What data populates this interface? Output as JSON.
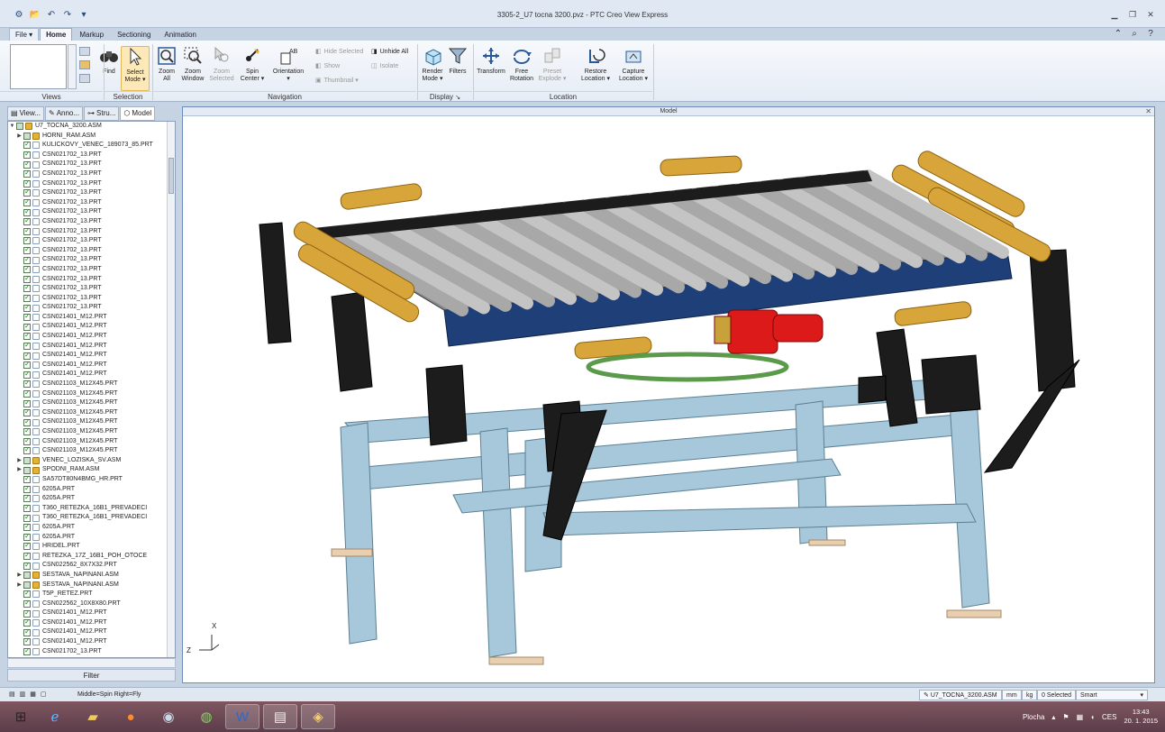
{
  "window": {
    "title": "3305-2_U7 tocna 3200.pvz - PTC Creo View Express"
  },
  "qat": {
    "icons": [
      "app-icon",
      "open-icon",
      "undo-icon",
      "redo-icon",
      "customize-icon"
    ]
  },
  "tabs": [
    {
      "label": "File ▾"
    },
    {
      "label": "Home"
    },
    {
      "label": "Markup"
    },
    {
      "label": "Sectioning"
    },
    {
      "label": "Animation"
    }
  ],
  "ribbon": {
    "find": "Find",
    "select_mode": [
      "Select",
      "Mode ▾"
    ],
    "zoom_all": [
      "Zoom",
      "All"
    ],
    "zoom_window": [
      "Zoom",
      "Window"
    ],
    "zoom_selected": [
      "Zoom",
      "Selected"
    ],
    "spin_center": [
      "Spin",
      "Center ▾"
    ],
    "orientation": [
      "Orientation",
      "▾"
    ],
    "hide_selected": "Hide Selected",
    "unhide_all": "Unhide All",
    "show": "Show",
    "isolate": "Isolate",
    "thumbnail": "Thumbnail ▾",
    "render_mode": [
      "Render",
      "Mode ▾"
    ],
    "filters": "Filters",
    "transform": "Transform",
    "free_rotation": [
      "Free",
      "Rotation"
    ],
    "preset_explode": [
      "Preset",
      "Explode ▾"
    ],
    "restore_location": [
      "Restore",
      "Location ▾"
    ],
    "capture_location": [
      "Capture",
      "Location ▾"
    ],
    "groups": {
      "views": "Views",
      "selection": "Selection",
      "navigation": "Navigation",
      "display": "Display",
      "location": "Location"
    }
  },
  "left_tabs": [
    {
      "label": "View..."
    },
    {
      "label": "Anno..."
    },
    {
      "label": "Stru..."
    },
    {
      "label": "Model"
    }
  ],
  "tree": [
    {
      "name": "U7_TOCNA_3200.ASM",
      "type": "asm",
      "level": 0,
      "twisty": "▼",
      "check": "part"
    },
    {
      "name": "HORNI_RAM.ASM",
      "type": "asm",
      "level": 1,
      "twisty": "▶",
      "check": "part"
    },
    {
      "name": "KULICKOVY_VENEC_189073_85.PRT",
      "type": "prt",
      "level": 1,
      "check": "on"
    },
    {
      "name": "CSN021702_13.PRT",
      "type": "prt",
      "level": 1,
      "check": "on"
    },
    {
      "name": "CSN021702_13.PRT",
      "type": "prt",
      "level": 1,
      "check": "on"
    },
    {
      "name": "CSN021702_13.PRT",
      "type": "prt",
      "level": 1,
      "check": "on"
    },
    {
      "name": "CSN021702_13.PRT",
      "type": "prt",
      "level": 1,
      "check": "on"
    },
    {
      "name": "CSN021702_13.PRT",
      "type": "prt",
      "level": 1,
      "check": "on"
    },
    {
      "name": "CSN021702_13.PRT",
      "type": "prt",
      "level": 1,
      "check": "on"
    },
    {
      "name": "CSN021702_13.PRT",
      "type": "prt",
      "level": 1,
      "check": "on"
    },
    {
      "name": "CSN021702_13.PRT",
      "type": "prt",
      "level": 1,
      "check": "on"
    },
    {
      "name": "CSN021702_13.PRT",
      "type": "prt",
      "level": 1,
      "check": "on"
    },
    {
      "name": "CSN021702_13.PRT",
      "type": "prt",
      "level": 1,
      "check": "on"
    },
    {
      "name": "CSN021702_13.PRT",
      "type": "prt",
      "level": 1,
      "check": "on"
    },
    {
      "name": "CSN021702_13.PRT",
      "type": "prt",
      "level": 1,
      "check": "on"
    },
    {
      "name": "CSN021702_13.PRT",
      "type": "prt",
      "level": 1,
      "check": "on"
    },
    {
      "name": "CSN021702_13.PRT",
      "type": "prt",
      "level": 1,
      "check": "on"
    },
    {
      "name": "CSN021702_13.PRT",
      "type": "prt",
      "level": 1,
      "check": "on"
    },
    {
      "name": "CSN021702_13.PRT",
      "type": "prt",
      "level": 1,
      "check": "on"
    },
    {
      "name": "CSN021702_13.PRT",
      "type": "prt",
      "level": 1,
      "check": "on"
    },
    {
      "name": "CSN021401_M12.PRT",
      "type": "prt",
      "level": 1,
      "check": "on"
    },
    {
      "name": "CSN021401_M12.PRT",
      "type": "prt",
      "level": 1,
      "check": "on"
    },
    {
      "name": "CSN021401_M12.PRT",
      "type": "prt",
      "level": 1,
      "check": "on"
    },
    {
      "name": "CSN021401_M12.PRT",
      "type": "prt",
      "level": 1,
      "check": "on"
    },
    {
      "name": "CSN021401_M12.PRT",
      "type": "prt",
      "level": 1,
      "check": "on"
    },
    {
      "name": "CSN021401_M12.PRT",
      "type": "prt",
      "level": 1,
      "check": "on"
    },
    {
      "name": "CSN021401_M12.PRT",
      "type": "prt",
      "level": 1,
      "check": "on"
    },
    {
      "name": "CSN021103_M12X45.PRT",
      "type": "prt",
      "level": 1,
      "check": "on"
    },
    {
      "name": "CSN021103_M12X45.PRT",
      "type": "prt",
      "level": 1,
      "check": "on"
    },
    {
      "name": "CSN021103_M12X45.PRT",
      "type": "prt",
      "level": 1,
      "check": "on"
    },
    {
      "name": "CSN021103_M12X45.PRT",
      "type": "prt",
      "level": 1,
      "check": "on"
    },
    {
      "name": "CSN021103_M12X45.PRT",
      "type": "prt",
      "level": 1,
      "check": "on"
    },
    {
      "name": "CSN021103_M12X45.PRT",
      "type": "prt",
      "level": 1,
      "check": "on"
    },
    {
      "name": "CSN021103_M12X45.PRT",
      "type": "prt",
      "level": 1,
      "check": "on"
    },
    {
      "name": "CSN021103_M12X45.PRT",
      "type": "prt",
      "level": 1,
      "check": "on"
    },
    {
      "name": "VENEC_LOZISKA_SV.ASM",
      "type": "asm",
      "level": 1,
      "twisty": "▶",
      "check": "part"
    },
    {
      "name": "SPODNI_RAM.ASM",
      "type": "asm",
      "level": 1,
      "twisty": "▶",
      "check": "part"
    },
    {
      "name": "SA57DT80N4BMG_HR.PRT",
      "type": "prt",
      "level": 1,
      "check": "on"
    },
    {
      "name": "6205A.PRT",
      "type": "prt",
      "level": 1,
      "check": "on"
    },
    {
      "name": "6205A.PRT",
      "type": "prt",
      "level": 1,
      "check": "on"
    },
    {
      "name": "T360_RETEZKA_16B1_PREVADECI",
      "type": "prt",
      "level": 1,
      "check": "on"
    },
    {
      "name": "T360_RETEZKA_16B1_PREVADECI",
      "type": "prt",
      "level": 1,
      "check": "on"
    },
    {
      "name": "6205A.PRT",
      "type": "prt",
      "level": 1,
      "check": "on"
    },
    {
      "name": "6205A.PRT",
      "type": "prt",
      "level": 1,
      "check": "on"
    },
    {
      "name": "HRIDEL.PRT",
      "type": "prt",
      "level": 1,
      "check": "on"
    },
    {
      "name": "RETEZKA_17Z_16B1_POH_OTOCE",
      "type": "prt",
      "level": 1,
      "check": "on"
    },
    {
      "name": "CSN022562_8X7X32.PRT",
      "type": "prt",
      "level": 1,
      "check": "on"
    },
    {
      "name": "SESTAVA_NAPINANI.ASM",
      "type": "asm",
      "level": 1,
      "twisty": "▶",
      "check": "part"
    },
    {
      "name": "SESTAVA_NAPINANI.ASM",
      "type": "asm",
      "level": 1,
      "twisty": "▶",
      "check": "part"
    },
    {
      "name": "T5P_RETEZ.PRT",
      "type": "prt",
      "level": 1,
      "check": "on"
    },
    {
      "name": "CSN022562_10X8X80.PRT",
      "type": "prt",
      "level": 1,
      "check": "on"
    },
    {
      "name": "CSN021401_M12.PRT",
      "type": "prt",
      "level": 1,
      "check": "on"
    },
    {
      "name": "CSN021401_M12.PRT",
      "type": "prt",
      "level": 1,
      "check": "on"
    },
    {
      "name": "CSN021401_M12.PRT",
      "type": "prt",
      "level": 1,
      "check": "on"
    },
    {
      "name": "CSN021401_M12.PRT",
      "type": "prt",
      "level": 1,
      "check": "on"
    },
    {
      "name": "CSN021702_13.PRT",
      "type": "prt",
      "level": 1,
      "check": "on"
    }
  ],
  "filter": {
    "label": "Filter"
  },
  "viewport": {
    "title": "Model",
    "axis_x": "X",
    "axis_z": "Z"
  },
  "statusbar": {
    "hint": "Middle=Spin  Right=Fly",
    "model": "U7_TOCNA_3200.ASM",
    "unit_length": "mm",
    "unit_mass": "kg",
    "selected": "0 Selected",
    "mode": "Smart"
  },
  "taskbar": {
    "apps": [
      "windows-start-icon",
      "ie-icon",
      "explorer-icon",
      "firefox-icon",
      "app-icon",
      "chrome-icon",
      "word-icon",
      "notepad-icon",
      "creo-icon"
    ],
    "desktop_label": "Plocha",
    "lang": "CES",
    "time": "13:43",
    "date": "20. 1. 2015"
  },
  "colors": {
    "accent": "#3a6aa8",
    "roller": "#d8a53a",
    "frame": "#9ec0d2",
    "motor": "#dd1a1a",
    "rail": "#1e3f78"
  }
}
